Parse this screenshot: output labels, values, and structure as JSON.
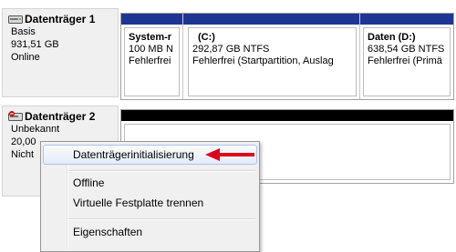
{
  "disks": [
    {
      "name": "Datenträger 1",
      "type": "Basis",
      "size": "931,51 GB",
      "status": "Online",
      "partitions": [
        {
          "title": "System-r",
          "size": "100 MB N",
          "status": "Fehlerfrei",
          "bar_color": "#1f3594"
        },
        {
          "title": "(C:)",
          "size": "292,87 GB NTFS",
          "status": "Fehlerfrei (Startpartition, Auslag",
          "bar_color": "#1f3594"
        },
        {
          "title": "Daten  (D:)",
          "size": "638,54 GB NTFS",
          "status": "Fehlerfrei (Primä",
          "bar_color": "#1f3594"
        }
      ]
    },
    {
      "name": "Datenträger 2",
      "type": "Unbekannt",
      "size": "20,00",
      "status": "Nicht",
      "unallocated_bar_color": "#000000"
    }
  ],
  "context_menu": {
    "items": [
      {
        "label": "Datenträgerinitialisierung",
        "highlighted": true
      },
      {
        "label": "Offline"
      },
      {
        "label": "Virtuelle Festplatte trennen"
      },
      {
        "label": "Eigenschaften"
      }
    ]
  },
  "annotation": {
    "arrow_color": "#e0001b",
    "arrow_icon": "red-arrow-left-icon"
  }
}
